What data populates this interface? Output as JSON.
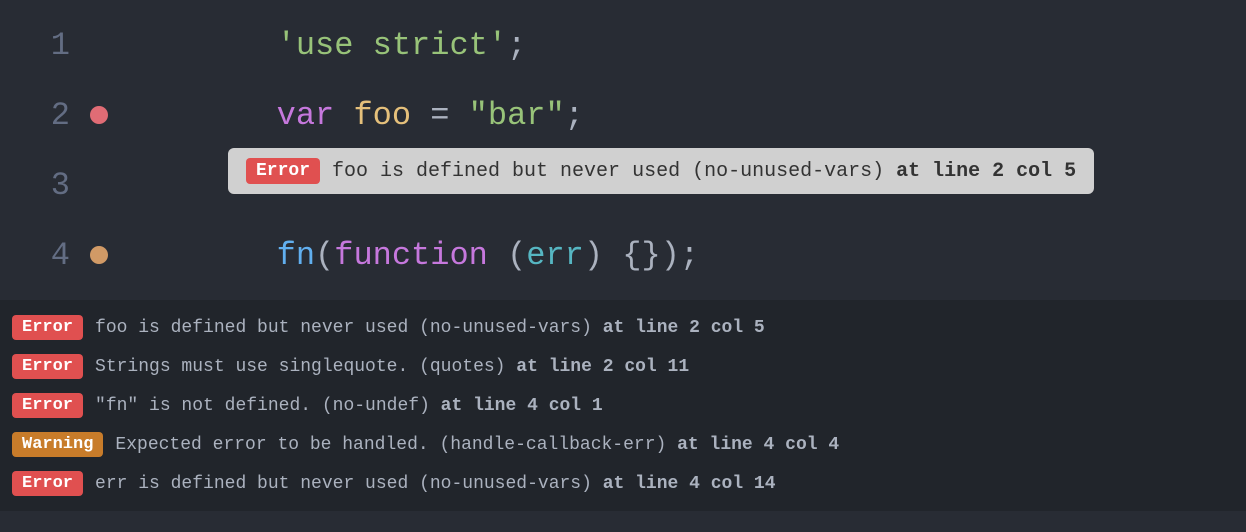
{
  "code": {
    "lines": [
      {
        "number": "1",
        "dot": "none",
        "content": "  'use strict';"
      },
      {
        "number": "2",
        "dot": "red",
        "content": "var foo = \"bar\";"
      },
      {
        "number": "3",
        "dot": "none",
        "content": ""
      },
      {
        "number": "4",
        "dot": "yellow",
        "content": "fn(function (err) {});"
      }
    ],
    "tooltip": {
      "badge": "Error",
      "message": "foo is defined but never used (no-unused-vars)",
      "location": " at line 2 col 5"
    }
  },
  "errors": [
    {
      "type": "error",
      "badge": "Error",
      "message": "foo is defined but never used (no-unused-vars)",
      "location": "at line 2 col 5"
    },
    {
      "type": "error",
      "badge": "Error",
      "message": "Strings must use singlequote. (quotes)",
      "location": "at line 2 col 11"
    },
    {
      "type": "error",
      "badge": "Error",
      "message": "\"fn\" is not defined. (no-undef)",
      "location": "at line 4 col 1"
    },
    {
      "type": "warning",
      "badge": "Warning",
      "message": "Expected error to be handled. (handle-callback-err)",
      "location": "at line 4 col 4"
    },
    {
      "type": "error",
      "badge": "Error",
      "message": "err is defined but never used (no-unused-vars)",
      "location": "at line 4 col 14"
    }
  ]
}
